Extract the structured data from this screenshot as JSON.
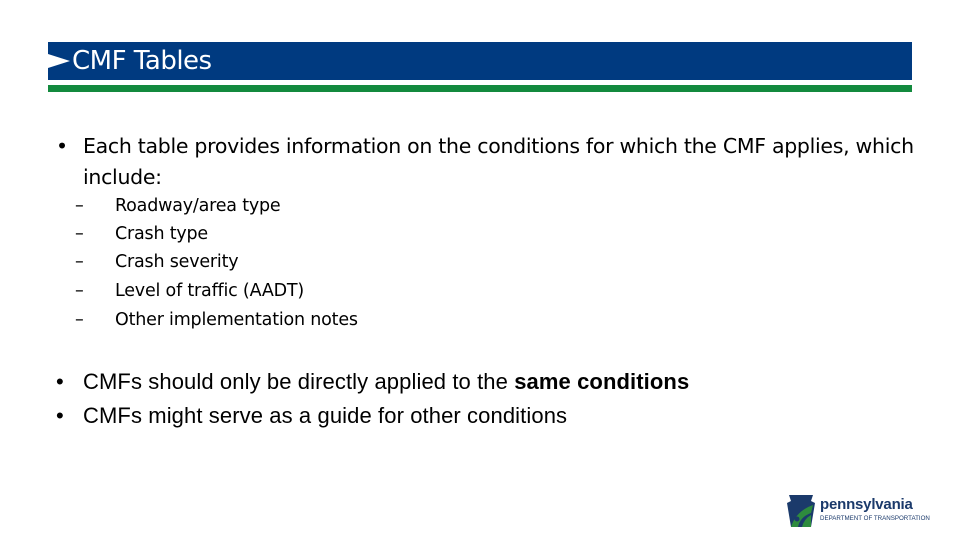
{
  "slide": {
    "title": "CMF Tables",
    "colors": {
      "title_bar": "#003a80",
      "accent_bar": "#138a3e",
      "title_text": "#ffffff"
    },
    "bullets": [
      {
        "text": "Each table provides information on the conditions for which the CMF applies, which include:",
        "sub_items": [
          "Roadway/area type",
          "Crash type",
          "Crash severity",
          "Level of traffic (AADT)",
          "Other implementation notes"
        ]
      },
      {
        "text_prefix": "CMFs should only be directly applied to the ",
        "text_bold": "same conditions"
      },
      {
        "text": "CMFs might serve as a guide for other conditions"
      }
    ],
    "bullet_glyph": "•",
    "dash_glyph": "–"
  },
  "logo": {
    "name": "pennsylvania",
    "subtitle": "DEPARTMENT OF TRANSPORTATION",
    "icon": "keystone-icon"
  }
}
